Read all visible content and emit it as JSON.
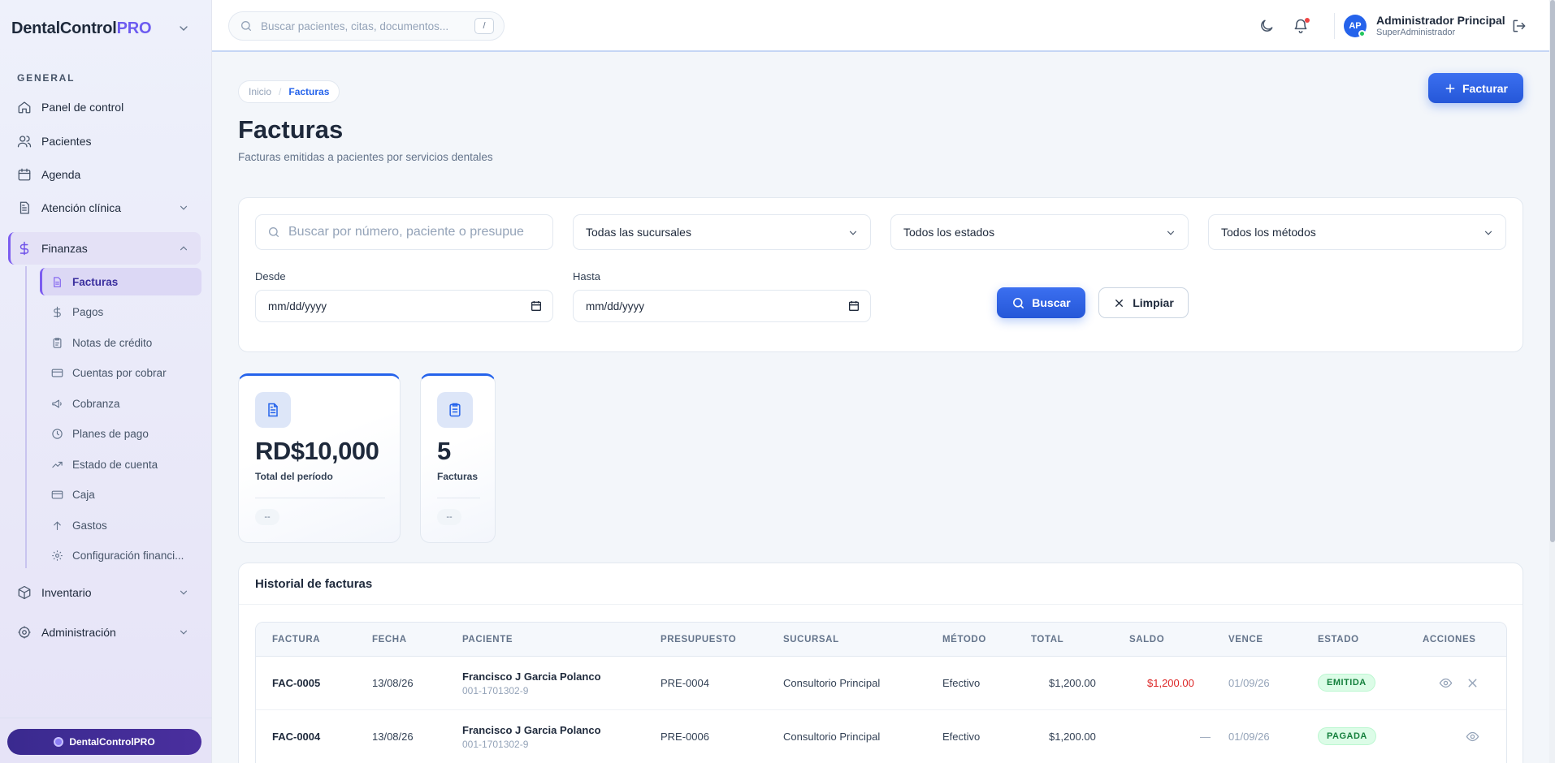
{
  "app": {
    "brand_main": "DentalControl",
    "brand_accent": "PRO",
    "footer_label": "DentalControlPRO"
  },
  "sidebar": {
    "section": "GENERAL",
    "items": [
      {
        "label": "Panel de control",
        "icon": "home-icon"
      },
      {
        "label": "Pacientes",
        "icon": "users-icon"
      },
      {
        "label": "Agenda",
        "icon": "calendar-icon"
      },
      {
        "label": "Atención clínica",
        "icon": "clipboard-icon"
      },
      {
        "label": "Finanzas",
        "icon": "dollar-icon"
      },
      {
        "label": "Inventario",
        "icon": "box-icon"
      },
      {
        "label": "Administración",
        "icon": "gear-icon"
      }
    ],
    "finanzas_sub": [
      {
        "label": "Facturas",
        "icon": "document-icon"
      },
      {
        "label": "Pagos",
        "icon": "dollar-icon"
      },
      {
        "label": "Notas de crédito",
        "icon": "clipboard-icon"
      },
      {
        "label": "Cuentas por cobrar",
        "icon": "card-icon"
      },
      {
        "label": "Cobranza",
        "icon": "megaphone-icon"
      },
      {
        "label": "Planes de pago",
        "icon": "clock-icon"
      },
      {
        "label": "Estado de cuenta",
        "icon": "trend-icon"
      },
      {
        "label": "Caja",
        "icon": "card-icon"
      },
      {
        "label": "Gastos",
        "icon": "arrow-up-icon"
      },
      {
        "label": "Configuración financi...",
        "icon": "gear-icon"
      }
    ]
  },
  "topbar": {
    "search_placeholder": "Buscar pacientes, citas, documentos...",
    "search_shortcut": "/",
    "user_initials": "AP",
    "user_name": "Administrador Principal",
    "user_role": "SuperAdministrador"
  },
  "page": {
    "breadcrumb_home": "Inicio",
    "breadcrumb_sep": "/",
    "breadcrumb_current": "Facturas",
    "title": "Facturas",
    "subtitle": "Facturas emitidas a pacientes por servicios dentales",
    "new_button": "Facturar"
  },
  "filters": {
    "search_placeholder": "Buscar por número, paciente o presupuesto",
    "branch": "Todas las sucursales",
    "status": "Todos los estados",
    "method": "Todos los métodos",
    "from_label": "Desde",
    "to_label": "Hasta",
    "from_value": "mm/dd/yyyy",
    "to_value": "mm/dd/yyyy",
    "search_button": "Buscar",
    "clear_button": "Limpiar"
  },
  "stats": [
    {
      "value": "RD$10,000",
      "label": "Total del período",
      "chip": "--"
    },
    {
      "value": "5",
      "label": "Facturas",
      "chip": "--"
    }
  ],
  "history": {
    "title": "Historial de facturas",
    "columns": [
      "FACTURA",
      "FECHA",
      "PACIENTE",
      "PRESUPUESTO",
      "SUCURSAL",
      "MÉTODO",
      "TOTAL",
      "SALDO",
      "VENCE",
      "ESTADO",
      "ACCIONES"
    ],
    "rows": [
      {
        "invoice": "FAC-0005",
        "date": "13/08/26",
        "patient": "Francisco J Garcia Polanco",
        "patient_id": "001-1701302-9",
        "budget": "PRE-0004",
        "branch": "Consultorio Principal",
        "method": "Efectivo",
        "total": "$1,200.00",
        "balance": "$1,200.00",
        "due": "01/09/26",
        "status": "EMITIDA"
      },
      {
        "invoice": "FAC-0004",
        "date": "13/08/26",
        "patient": "Francisco J Garcia Polanco",
        "patient_id": "001-1701302-9",
        "budget": "PRE-0006",
        "branch": "Consultorio Principal",
        "method": "Efectivo",
        "total": "$1,200.00",
        "balance": "—",
        "due": "01/09/26",
        "status": "PAGADA"
      }
    ]
  },
  "colors": {
    "primary": "#2563eb",
    "accent": "#6d5bf0",
    "danger": "#dc2626",
    "success": "#15803d"
  }
}
